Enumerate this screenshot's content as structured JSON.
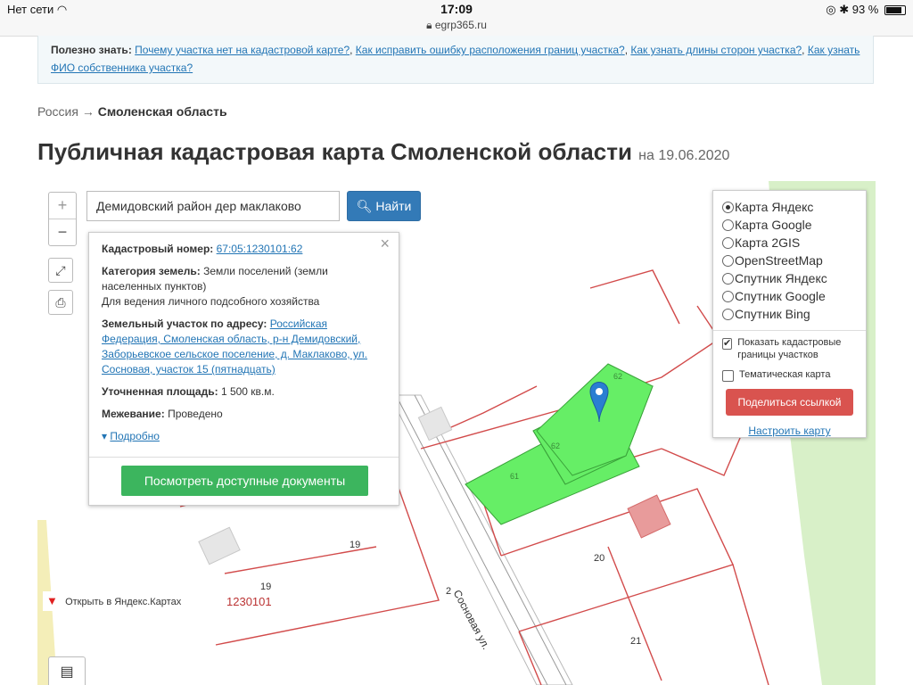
{
  "status": {
    "carrier": "Нет сети",
    "time": "17:09",
    "url": "egrp365.ru",
    "battery": "93 %",
    "battery_level": 0.93
  },
  "info": {
    "prefix": "Полезно знать:",
    "links": [
      "Почему участка нет на кадастровой карте?",
      "Как исправить ошибку расположения границ участка?",
      "Как узнать длины сторон участка?",
      "Как узнать ФИО собственника участка?"
    ]
  },
  "breadcrumb": {
    "root": "Россия",
    "arrow": "→",
    "current": "Смоленская область"
  },
  "page": {
    "title": "Публичная кадастровая карта Смоленской области",
    "date": "на 19.06.2020"
  },
  "map": {
    "zoom_in": "+",
    "zoom_out": "−",
    "search_value": "Демидовский район дер маклаково",
    "find_button": "Найти",
    "labels": {
      "p19a": "19",
      "p19b": "19",
      "block": "1230101",
      "p2": "2",
      "p20": "20",
      "p21": "21",
      "street": "Сосновая ул.",
      "pl61": "61",
      "pl62a": "62",
      "pl62b": "62"
    },
    "yandex_link": "Открыть в Яндекс.Картах"
  },
  "popup": {
    "close": "×",
    "cadastral_label": "Кадастровый номер:",
    "cadastral_value": "67:05:1230101:62",
    "category_label": "Категория земель:",
    "category_value": "Земли поселений (земли населенных пунктов)",
    "usage": "Для ведения личного подсобного хозяйства",
    "address_label": "Земельный участок по адресу:",
    "address_value": "Российская Федерация, Смоленская область, р-н Демидовский, Заборьевское сельское поселение, д. Маклаково, ул. Сосновая, участок 15 (пятнадцать)",
    "area_label": "Уточненная площадь:",
    "area_value": "1 500 кв.м.",
    "survey_label": "Межевание:",
    "survey_value": "Проведено",
    "more": "Подробно",
    "docs_button": "Посмотреть доступные документы"
  },
  "layers": {
    "options": [
      "Карта Яндекс",
      "Карта Google",
      "Карта 2GIS",
      "OpenStreetMap",
      "Спутник Яндекс",
      "Спутник Google",
      "Спутник Bing"
    ],
    "selected": 0,
    "checkbox1": "Показать кадастровые границы участков",
    "checkbox1_checked": true,
    "checkbox2": "Тематическая карта",
    "checkbox2_checked": false,
    "share_button": "Поделиться ссылкой",
    "setup_link": "Настроить карту"
  },
  "colors": {
    "link": "#2275b5",
    "primary": "#337ab7",
    "success": "#3cb55e",
    "danger": "#d9534f",
    "parcel_fill": "#66ee66",
    "parcel_line": "#d24b4b"
  }
}
